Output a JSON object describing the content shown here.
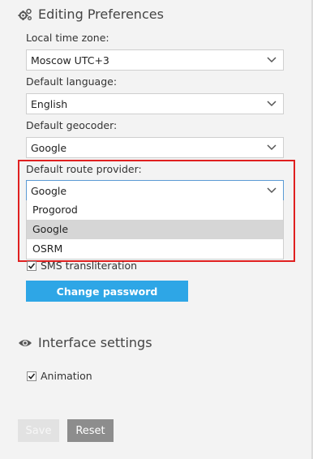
{
  "editing": {
    "title": "Editing Preferences",
    "icon": "gears-icon",
    "timezone": {
      "label": "Local time zone:",
      "value": "Moscow UTC+3"
    },
    "language": {
      "label": "Default language:",
      "value": "English"
    },
    "geocoder": {
      "label": "Default geocoder:",
      "value": "Google"
    },
    "route_provider": {
      "label": "Default route provider:",
      "value": "Google",
      "options": [
        "Progorod",
        "Google",
        "OSRM"
      ],
      "highlighted_option": "Google"
    },
    "sms_transliteration": {
      "label": "SMS transliteration",
      "checked": true
    },
    "change_password_label": "Change password"
  },
  "interface": {
    "title": "Interface settings",
    "icon": "eye-icon",
    "animation": {
      "label": "Animation",
      "checked": true
    }
  },
  "actions": {
    "save_label": "Save",
    "reset_label": "Reset"
  },
  "colors": {
    "accent": "#2ea6e6",
    "highlight_border": "#e02020",
    "background": "#f3f3f3"
  }
}
